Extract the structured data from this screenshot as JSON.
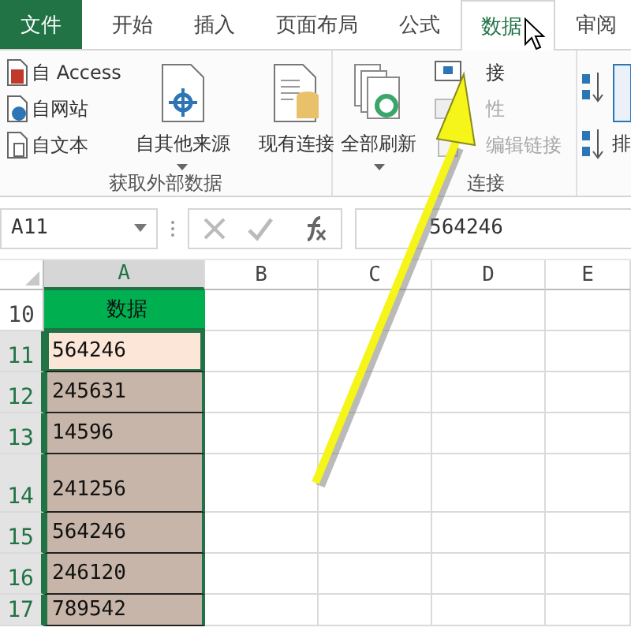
{
  "tabs": [
    {
      "label": "文件",
      "kind": "file",
      "selected": false
    },
    {
      "label": "开始",
      "kind": "tab",
      "selected": false
    },
    {
      "label": "插入",
      "kind": "tab",
      "selected": false
    },
    {
      "label": "页面布局",
      "kind": "tab",
      "selected": false
    },
    {
      "label": "公式",
      "kind": "tab",
      "selected": false
    },
    {
      "label": "数据",
      "kind": "tab",
      "selected": true
    },
    {
      "label": "审阅",
      "kind": "tab",
      "selected": false
    }
  ],
  "ribbon": {
    "groups": [
      {
        "label": "获取外部数据",
        "items": [
          {
            "kind": "small",
            "label": "自 Access",
            "disabled": false
          },
          {
            "kind": "small",
            "label": "自网站",
            "disabled": false
          },
          {
            "kind": "small",
            "label": "自文本",
            "disabled": false
          },
          {
            "kind": "big",
            "label": "自其他来源",
            "dropdown": true,
            "disabled": false
          },
          {
            "kind": "big",
            "label": "现有连接",
            "dropdown": false,
            "disabled": false
          }
        ]
      },
      {
        "label": "连接",
        "items": [
          {
            "kind": "big",
            "label": "全部刷新",
            "dropdown": true,
            "disabled": false
          },
          {
            "kind": "small",
            "label": "接",
            "disabled": false
          },
          {
            "kind": "small",
            "label": "性",
            "disabled": true
          },
          {
            "kind": "small",
            "label": "编辑链接",
            "disabled": true
          }
        ]
      },
      {
        "items": [
          {
            "kind": "sort",
            "label": "排"
          }
        ]
      }
    ]
  },
  "formula_bar": {
    "name_box": "A11",
    "value": "564246"
  },
  "sheet": {
    "columns": [
      {
        "label": "A",
        "selected": true
      },
      {
        "label": "B",
        "selected": false
      },
      {
        "label": "C",
        "selected": false
      },
      {
        "label": "D",
        "selected": false
      },
      {
        "label": "E",
        "selected": false
      }
    ],
    "rows": [
      {
        "header": "10",
        "kind": "header",
        "cell": "数据",
        "selected": false,
        "active": false,
        "tall": false
      },
      {
        "header": "11",
        "kind": "value",
        "cell": "564246",
        "selected": true,
        "active": true,
        "tall": false
      },
      {
        "header": "12",
        "kind": "value",
        "cell": "245631",
        "selected": true,
        "active": false,
        "tall": false
      },
      {
        "header": "13",
        "kind": "value",
        "cell": "14596",
        "selected": true,
        "active": false,
        "tall": false
      },
      {
        "header": "14",
        "kind": "value",
        "cell": "241256",
        "selected": true,
        "active": false,
        "tall": true
      },
      {
        "header": "15",
        "kind": "value",
        "cell": "564246",
        "selected": true,
        "active": false,
        "tall": false
      },
      {
        "header": "16",
        "kind": "value",
        "cell": "246120",
        "selected": true,
        "active": false,
        "tall": false
      },
      {
        "header": "17",
        "kind": "value",
        "cell": "789542",
        "selected": true,
        "active": false,
        "tall": false
      }
    ]
  }
}
